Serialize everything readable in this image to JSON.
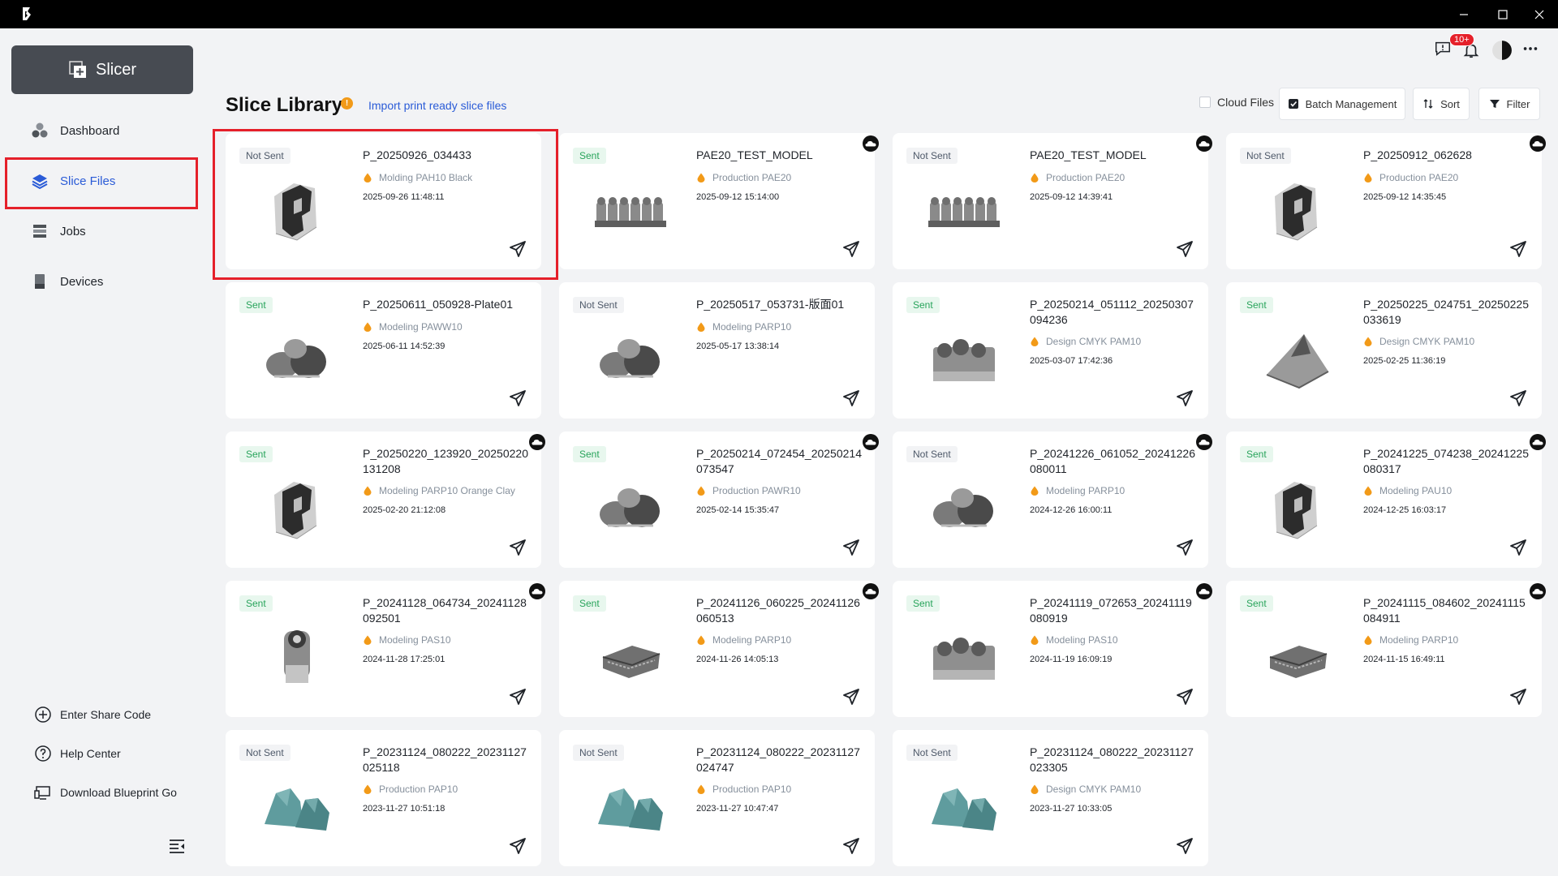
{
  "sidebar": {
    "slicer_label": "Slicer",
    "nav": [
      {
        "label": "Dashboard",
        "icon": "dashboard-icon",
        "active": false
      },
      {
        "label": "Slice Files",
        "icon": "layers-icon",
        "active": true
      },
      {
        "label": "Jobs",
        "icon": "jobs-icon",
        "active": false
      },
      {
        "label": "Devices",
        "icon": "device-icon",
        "active": false
      }
    ],
    "links": [
      {
        "label": "Enter Share Code",
        "icon": "plus-circle-icon"
      },
      {
        "label": "Help Center",
        "icon": "help-circle-icon"
      },
      {
        "label": "Download Blueprint Go",
        "icon": "monitor-download-icon"
      }
    ]
  },
  "topbar": {
    "notification_badge": "10+"
  },
  "header": {
    "title": "Slice Library",
    "info_mark": "!",
    "import_link": "Import print ready slice files",
    "cloud_files": "Cloud Files",
    "batch_management": "Batch Management",
    "sort": "Sort",
    "filter": "Filter"
  },
  "accent": "#2a5bd7",
  "files": [
    {
      "status": "Not Sent",
      "name": "P_20250926_034433",
      "material": "Molding PAH10 Black",
      "date": "2025-09-26 11:48:11",
      "cloud": false,
      "thumb": "frame"
    },
    {
      "status": "Sent",
      "name": "PAE20_TEST_MODEL",
      "material": "Production PAE20",
      "date": "2025-09-12 15:14:00",
      "cloud": true,
      "thumb": "row"
    },
    {
      "status": "Not Sent",
      "name": "PAE20_TEST_MODEL",
      "material": "Production PAE20",
      "date": "2025-09-12 14:39:41",
      "cloud": true,
      "thumb": "row"
    },
    {
      "status": "Not Sent",
      "name": "P_20250912_062628",
      "material": "Production PAE20",
      "date": "2025-09-12 14:35:45",
      "cloud": true,
      "thumb": "frame"
    },
    {
      "status": "Sent",
      "name": "P_20250611_050928-Plate01",
      "material": "Modeling PAWW10",
      "date": "2025-06-11 14:52:39",
      "cloud": false,
      "thumb": "blob"
    },
    {
      "status": "Not Sent",
      "name": "P_20250517_053731-版面01",
      "material": "Modeling PARP10",
      "date": "2025-05-17 13:38:14",
      "cloud": false,
      "thumb": "blob"
    },
    {
      "status": "Sent",
      "name": "P_20250214_051112_20250307094236",
      "material": "Design CMYK PAM10",
      "date": "2025-03-07 17:42:36",
      "cloud": false,
      "thumb": "block"
    },
    {
      "status": "Sent",
      "name": "P_20250225_024751_20250225033619",
      "material": "Design CMYK PAM10",
      "date": "2025-02-25 11:36:19",
      "cloud": false,
      "thumb": "pyramid"
    },
    {
      "status": "Sent",
      "name": "P_20250220_123920_20250220131208",
      "material": "Modeling PARP10 Orange Clay",
      "date": "2025-02-20 21:12:08",
      "cloud": true,
      "thumb": "frame"
    },
    {
      "status": "Sent",
      "name": "P_20250214_072454_20250214073547",
      "material": "Production PAWR10",
      "date": "2025-02-14 15:35:47",
      "cloud": true,
      "thumb": "blob"
    },
    {
      "status": "Not Sent",
      "name": "P_20241226_061052_20241226080011",
      "material": "Modeling PARP10",
      "date": "2024-12-26 16:00:11",
      "cloud": true,
      "thumb": "blob"
    },
    {
      "status": "Sent",
      "name": "P_20241225_074238_20241225080317",
      "material": "Modeling PAU10",
      "date": "2024-12-25 16:03:17",
      "cloud": true,
      "thumb": "frame"
    },
    {
      "status": "Sent",
      "name": "P_20241128_064734_20241128092501",
      "material": "Modeling PAS10",
      "date": "2024-11-28 17:25:01",
      "cloud": true,
      "thumb": "cylinder"
    },
    {
      "status": "Sent",
      "name": "P_20241126_060225_20241126060513",
      "material": "Modeling PARP10",
      "date": "2024-11-26 14:05:13",
      "cloud": true,
      "thumb": "flat"
    },
    {
      "status": "Sent",
      "name": "P_20241119_072653_20241119080919",
      "material": "Modeling PAS10",
      "date": "2024-11-19 16:09:19",
      "cloud": true,
      "thumb": "block"
    },
    {
      "status": "Sent",
      "name": "P_20241115_084602_20241115084911",
      "material": "Modeling PARP10",
      "date": "2024-11-15 16:49:11",
      "cloud": true,
      "thumb": "flat"
    },
    {
      "status": "Not Sent",
      "name": "P_20231124_080222_20231127025118",
      "material": "Production PAP10",
      "date": "2023-11-27 10:51:18",
      "cloud": false,
      "thumb": "teal"
    },
    {
      "status": "Not Sent",
      "name": "P_20231124_080222_20231127024747",
      "material": "Production PAP10",
      "date": "2023-11-27 10:47:47",
      "cloud": false,
      "thumb": "teal"
    },
    {
      "status": "Not Sent",
      "name": "P_20231124_080222_20231127023305",
      "material": "Design CMYK PAM10",
      "date": "2023-11-27 10:33:05",
      "cloud": false,
      "thumb": "teal"
    }
  ]
}
